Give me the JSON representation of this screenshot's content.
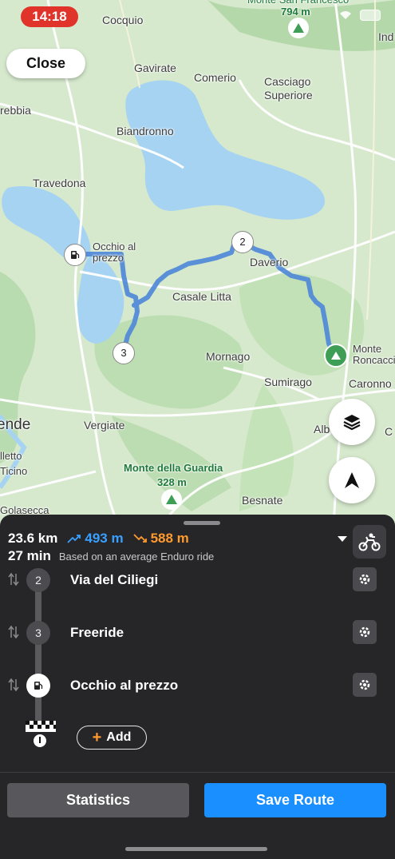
{
  "status_bar": {
    "time": "14:18"
  },
  "top": {
    "close_label": "Close"
  },
  "map": {
    "labels": {
      "cocquio": "Cocquio",
      "monte_san_francesco": "Monte San Francesco",
      "monte_san_francesco_elev": "794 m",
      "ind": "Ind",
      "gavirate": "Gavirate",
      "comerio": "Comerio",
      "casciago": "Casciago",
      "superiore": "Superiore",
      "rebbia": "rebbia",
      "biandronno": "Biandronno",
      "travedona": "Travedona",
      "occhio_al_prezzo": "Occhio al\nprezzo",
      "daverio": "Daverio",
      "casale_litta": "Casale Litta",
      "monte_roncaccio": "Monte\nRoncaccio",
      "mornago": "Mornago",
      "sumirago": "Sumirago",
      "caronno": "Caronno",
      "ende": "ende",
      "vergiate": "Vergiate",
      "alb": "Alb",
      "lletto": "lletto",
      "ticino": "Ticino",
      "monte_della_guardia": "Monte della Guardia",
      "monte_della_guardia_elev": "328 m",
      "besnate": "Besnate",
      "golasecca": "Golasecca",
      "c_edge": "C"
    },
    "waypoints": {
      "wp2": "2",
      "wp3": "3"
    },
    "icons": [
      "layers-icon",
      "navigate-arrow-icon",
      "fuel-pump-icon",
      "mountain-peak-icon",
      "start-flag-icon"
    ]
  },
  "route_summary": {
    "distance": "23.6 km",
    "ascent": "493 m",
    "descent": "588 m",
    "duration": "27 min",
    "basis": "Based on an average Enduro ride",
    "vehicle_icon": "motorbike-icon",
    "ascent_color": "#3aa0ff",
    "descent_color": "#ff9a2e"
  },
  "stops": [
    {
      "index": "2",
      "name": "Via del Ciliegi"
    },
    {
      "index": "3",
      "name": "Freeride"
    },
    {
      "index": "",
      "name": "Occhio al prezzo"
    }
  ],
  "add_label": "Add",
  "buttons": {
    "statistics": "Statistics",
    "save_route": "Save Route"
  },
  "colors": {
    "route": "#4d86d8",
    "save_button": "#1a8fff",
    "sheet_bg": "#262628"
  }
}
